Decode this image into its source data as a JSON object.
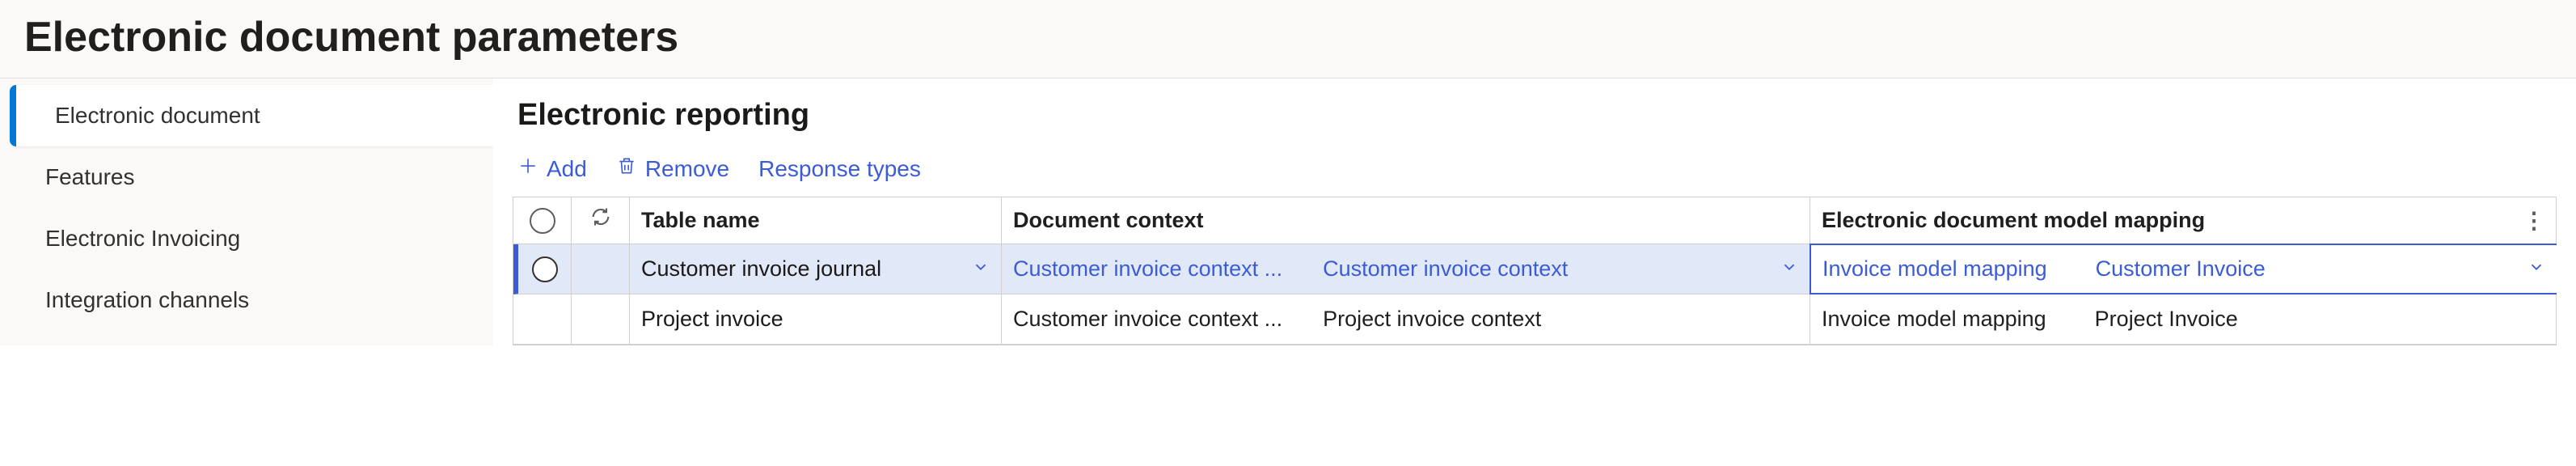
{
  "page": {
    "title": "Electronic document parameters"
  },
  "sidebar": {
    "items": [
      {
        "label": "Electronic document",
        "active": true
      },
      {
        "label": "Features",
        "active": false
      },
      {
        "label": "Electronic Invoicing",
        "active": false
      },
      {
        "label": "Integration channels",
        "active": false
      }
    ]
  },
  "section": {
    "title": "Electronic reporting"
  },
  "toolbar": {
    "add_label": "Add",
    "remove_label": "Remove",
    "response_types_label": "Response types"
  },
  "grid": {
    "headers": {
      "table_name": "Table name",
      "document_context": "Document context",
      "model_mapping": "Electronic document model mapping"
    },
    "rows": [
      {
        "selected": true,
        "table_name": "Customer invoice journal",
        "doc_ctx_primary": "Customer invoice context ...",
        "doc_ctx_secondary": "Customer invoice context",
        "mm_primary": "Invoice model mapping",
        "mm_secondary": "Customer Invoice"
      },
      {
        "selected": false,
        "table_name": "Project invoice",
        "doc_ctx_primary": "Customer invoice context ...",
        "doc_ctx_secondary": "Project invoice context",
        "mm_primary": "Invoice model mapping",
        "mm_secondary": "Project Invoice"
      }
    ]
  }
}
